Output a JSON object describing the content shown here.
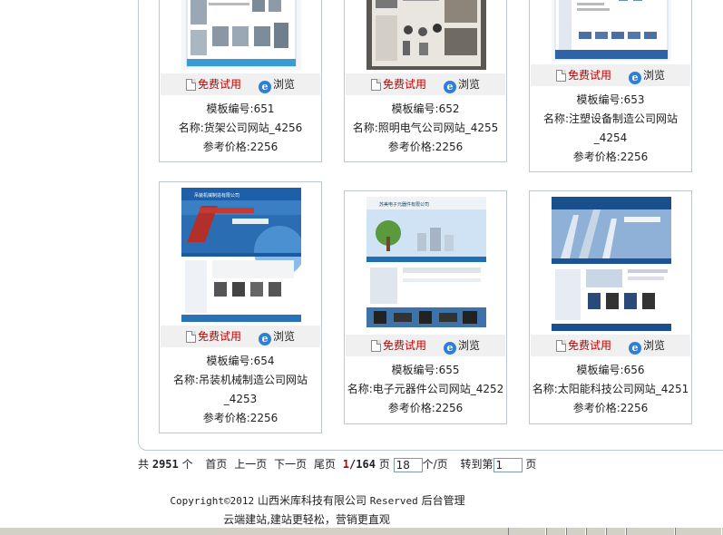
{
  "actions": {
    "free_trial": "免费试用",
    "browse": "浏览"
  },
  "labels": {
    "code": "模板编号:",
    "name": "名称:",
    "price": "参考价格:"
  },
  "cards": [
    {
      "code": "651",
      "name": "货架公司网站_4256",
      "price": "2256"
    },
    {
      "code": "652",
      "name": "照明电气公司网站_4255",
      "price": "2256"
    },
    {
      "code": "653",
      "name_line1": "注塑设备制造公司网站",
      "name_line2": "_4254",
      "price": "2256"
    },
    {
      "code": "654",
      "name_line1": "吊装机械制造公司网站",
      "name_line2": "_4253",
      "price": "2256"
    },
    {
      "code": "655",
      "name": "电子元器件公司网站_4252",
      "price": "2256"
    },
    {
      "code": "656",
      "name": "太阳能科技公司网站_4251",
      "price": "2256"
    }
  ],
  "thumb_captions": {
    "t654": "吊装机械制造有限公司",
    "t655": "苏美电子元器件有限公司"
  },
  "pager": {
    "total_prefix": "共",
    "total": "2951",
    "total_suffix": "个",
    "first": "首页",
    "prev": "上一页",
    "next": "下一页",
    "last": "尾页",
    "current": "1",
    "pages": "/164",
    "page_suffix": "页",
    "per_page": "18",
    "per_page_suffix": "个/页",
    "goto_label": "转到第",
    "goto_value": "1",
    "goto_suffix": "页"
  },
  "footer": {
    "copyright": "Copyright©2012",
    "company": "山西米库科技有限公司",
    "reserved": "Reserved",
    "admin": "后台管理",
    "slogan": "云端建站,建站更轻松，营销更直观"
  }
}
